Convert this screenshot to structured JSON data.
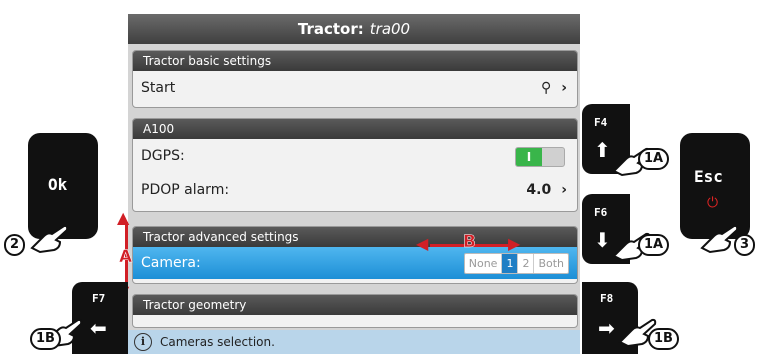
{
  "screen": {
    "title_label": "Tractor:",
    "title_value": "tra00",
    "panels": [
      {
        "header": "Tractor basic settings",
        "rows": [
          {
            "label": "Start",
            "value_icon": "pin-icon"
          }
        ]
      },
      {
        "header": "A100",
        "rows": [
          {
            "label": "DGPS:",
            "toggle_text": "I",
            "toggle_state": "on"
          },
          {
            "label": "PDOP alarm:",
            "value": "4.0"
          }
        ]
      },
      {
        "header": "Tractor advanced settings",
        "rows": [
          {
            "label": "Camera:",
            "options": [
              "None",
              "1",
              "2",
              "Both"
            ],
            "selected": "1"
          }
        ]
      },
      {
        "header": "Tractor geometry",
        "rows": []
      }
    ],
    "info_icon": "i",
    "info_text": "Cameras selection."
  },
  "keys": {
    "ok": {
      "label": "Ok",
      "badge": "2"
    },
    "f4": {
      "label": "F4",
      "icon": "arrow-up-icon",
      "badge": "1A"
    },
    "f6": {
      "label": "F6",
      "icon": "arrow-down-icon",
      "badge": "1A"
    },
    "esc": {
      "label": "Esc",
      "icon": "power-icon",
      "badge": "3"
    },
    "f7": {
      "label": "F7",
      "icon": "arrow-left-icon",
      "badge": "1B"
    },
    "f8": {
      "label": "F8",
      "icon": "arrow-right-icon",
      "badge": "1B"
    }
  },
  "annotations": {
    "vertical": "A",
    "horizontal": "B",
    "color": "#d11f26"
  },
  "glyphs": {
    "chevron": "›",
    "pin": "⚲",
    "up": "⬆",
    "down": "⬇",
    "left": "⬅",
    "right": "➡",
    "power": "⏻"
  }
}
